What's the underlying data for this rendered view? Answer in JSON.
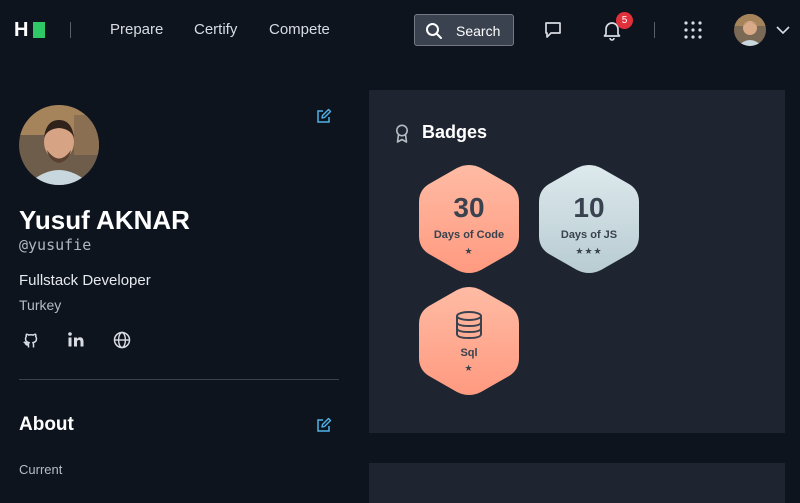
{
  "nav": {
    "logo_letter": "H",
    "links": [
      "Prepare",
      "Certify",
      "Compete"
    ],
    "search_label": "Search",
    "notification_count": "5"
  },
  "profile": {
    "name": "Yusuf AKNAR",
    "handle": "@yusufie",
    "job_title": "Fullstack Developer",
    "country": "Turkey",
    "social_icons": [
      "github-icon",
      "linkedin-icon",
      "globe-icon"
    ]
  },
  "about": {
    "title": "About",
    "current_label": "Current"
  },
  "badges": {
    "title": "Badges",
    "items": [
      {
        "count": "30",
        "name": "Days of Code",
        "stars": "★",
        "color_top": "#ffb39c",
        "color_bottom": "#ff9a82"
      },
      {
        "count": "10",
        "name": "Days of JS",
        "stars": "★★★",
        "color_top": "#d8e6ea",
        "color_bottom": "#b9cdd3"
      },
      {
        "icon": "database-icon",
        "name": "Sql",
        "stars": "★",
        "color_top": "#ffb39c",
        "color_bottom": "#ff9a82"
      }
    ]
  },
  "colors": {
    "background": "#0e141e",
    "card": "#1f2530",
    "accent": "#2ec866",
    "edit_icon": "#4fb3e8",
    "notification": "#e0303b"
  }
}
